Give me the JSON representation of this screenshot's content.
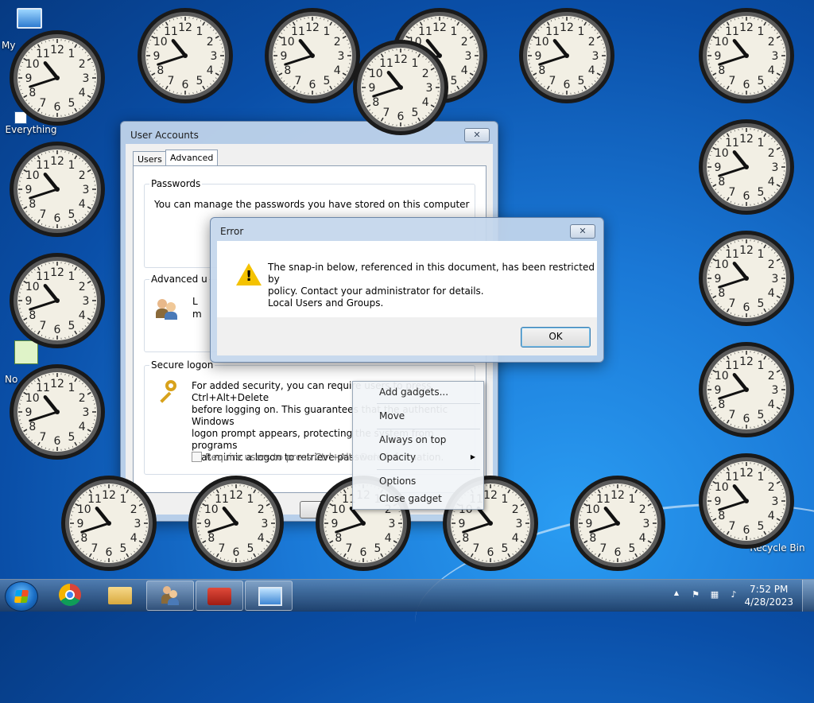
{
  "desktop": {
    "icons": [
      {
        "label": "My"
      },
      {
        "label": "Everything"
      },
      {
        "label": "No"
      },
      {
        "label": "Recycle Bin"
      }
    ]
  },
  "user_accounts": {
    "title": "User Accounts",
    "tabs": [
      "Users",
      "Advanced"
    ],
    "active_tab": "Advanced",
    "passwords": {
      "heading": "Passwords",
      "text": "You can manage the passwords you have stored on this computer"
    },
    "advanced": {
      "heading": "Advanced u",
      "text_lines": [
        "L",
        "m"
      ]
    },
    "secure_logon": {
      "heading": "Secure logon",
      "text_lines": [
        "For added security, you can require users to press Ctrl+Alt+Delete",
        "before logging on. This guarantees that the authentic Windows",
        "logon prompt appears, protecting the system from programs",
        "that mimic a logon to retrieve password information."
      ],
      "checkbox_label": "Require users to press Ctrl+Alt+Delete",
      "checkbox_checked": false
    }
  },
  "error_dialog": {
    "title": "Error",
    "message_lines": [
      "The snap-in below, referenced in this document, has been restricted by",
      "policy. Contact your administrator for details.",
      "Local Users and Groups."
    ],
    "ok_label": "OK"
  },
  "context_menu": {
    "items": [
      "Add gadgets...",
      "Move",
      "Always on top",
      "Opacity",
      "Options",
      "Close gadget"
    ],
    "opacity_arrow": "▶"
  },
  "clocks": {
    "count": 22,
    "time_shown": "10:42",
    "numerals": [
      "12",
      "1",
      "2",
      "3",
      "4",
      "5",
      "6",
      "7",
      "8",
      "9",
      "10",
      "11"
    ]
  },
  "taskbar": {
    "time": "7:52 PM",
    "date": "4/28/2023",
    "tray_arrow": "▲",
    "items": [
      "chrome-icon",
      "file-explorer-icon",
      "user-accounts-icon",
      "toolbox-icon",
      "remote-desktop-icon"
    ]
  },
  "colors": {
    "accent": "#1a78d6",
    "warning": "#f4c200"
  }
}
